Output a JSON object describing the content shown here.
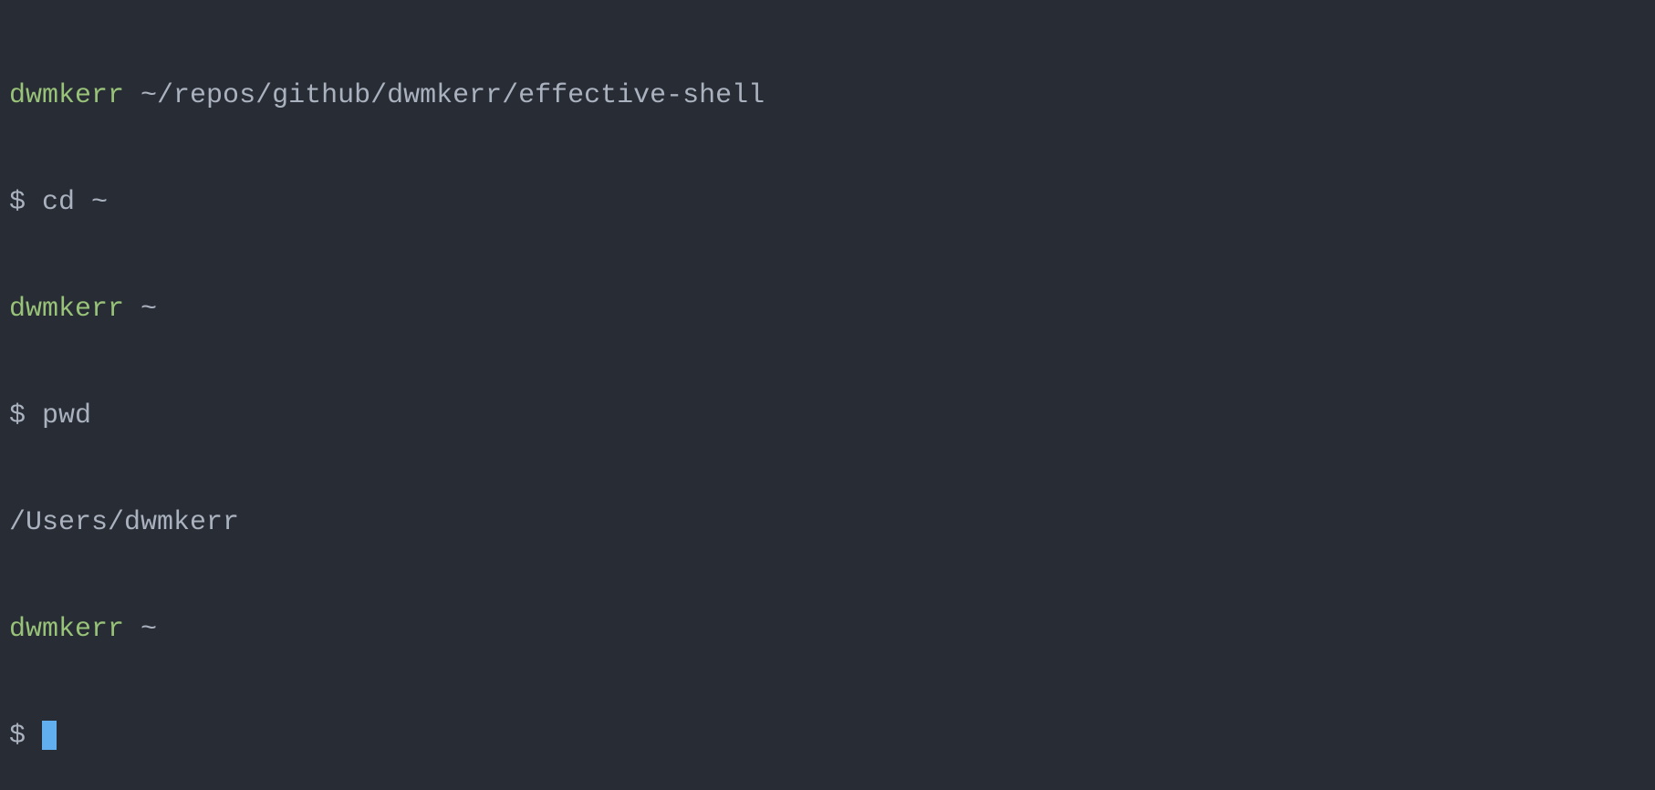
{
  "terminal": {
    "lines": [
      {
        "type": "prompt-header",
        "user": "dwmkerr",
        "path": "~/repos/github/dwmkerr/effective-shell"
      },
      {
        "type": "command-line",
        "symbol": "$",
        "command": "cd ~"
      },
      {
        "type": "prompt-header",
        "user": "dwmkerr",
        "path": "~"
      },
      {
        "type": "command-line",
        "symbol": "$",
        "command": "pwd"
      },
      {
        "type": "output",
        "text": "/Users/dwmkerr"
      },
      {
        "type": "prompt-header",
        "user": "dwmkerr",
        "path": "~"
      },
      {
        "type": "active-prompt",
        "symbol": "$"
      }
    ]
  }
}
